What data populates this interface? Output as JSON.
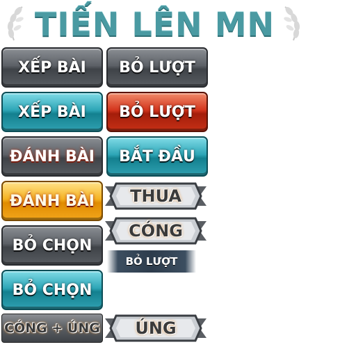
{
  "title": "TIẾN LÊN MN",
  "buttons": {
    "sort_gray": "XẾP BÀI",
    "pass_gray": "BỎ LƯỢT",
    "sort_teal": "XẾP BÀI",
    "pass_red": "BỎ LƯỢT",
    "play_gray": "ĐÁNH BÀI",
    "start_teal": "BẮT ĐẦU",
    "play_orange": "ĐÁNH BÀI",
    "deselect_gray": "BỎ CHỌN",
    "deselect_teal": "BỎ CHỌN"
  },
  "ribbons": {
    "lose": "THUA",
    "cong": "CÓNG",
    "ung": "ÚNG"
  },
  "badges": {
    "pass_small": "BỎ LƯỢT",
    "cong_plus_ung": "CÓNG + ÚNG"
  },
  "colors": {
    "title": "#4a9aa2",
    "gray": "#5d6167",
    "teal": "#2ea6b7",
    "red": "#d4351d",
    "orange": "#f5b322"
  }
}
